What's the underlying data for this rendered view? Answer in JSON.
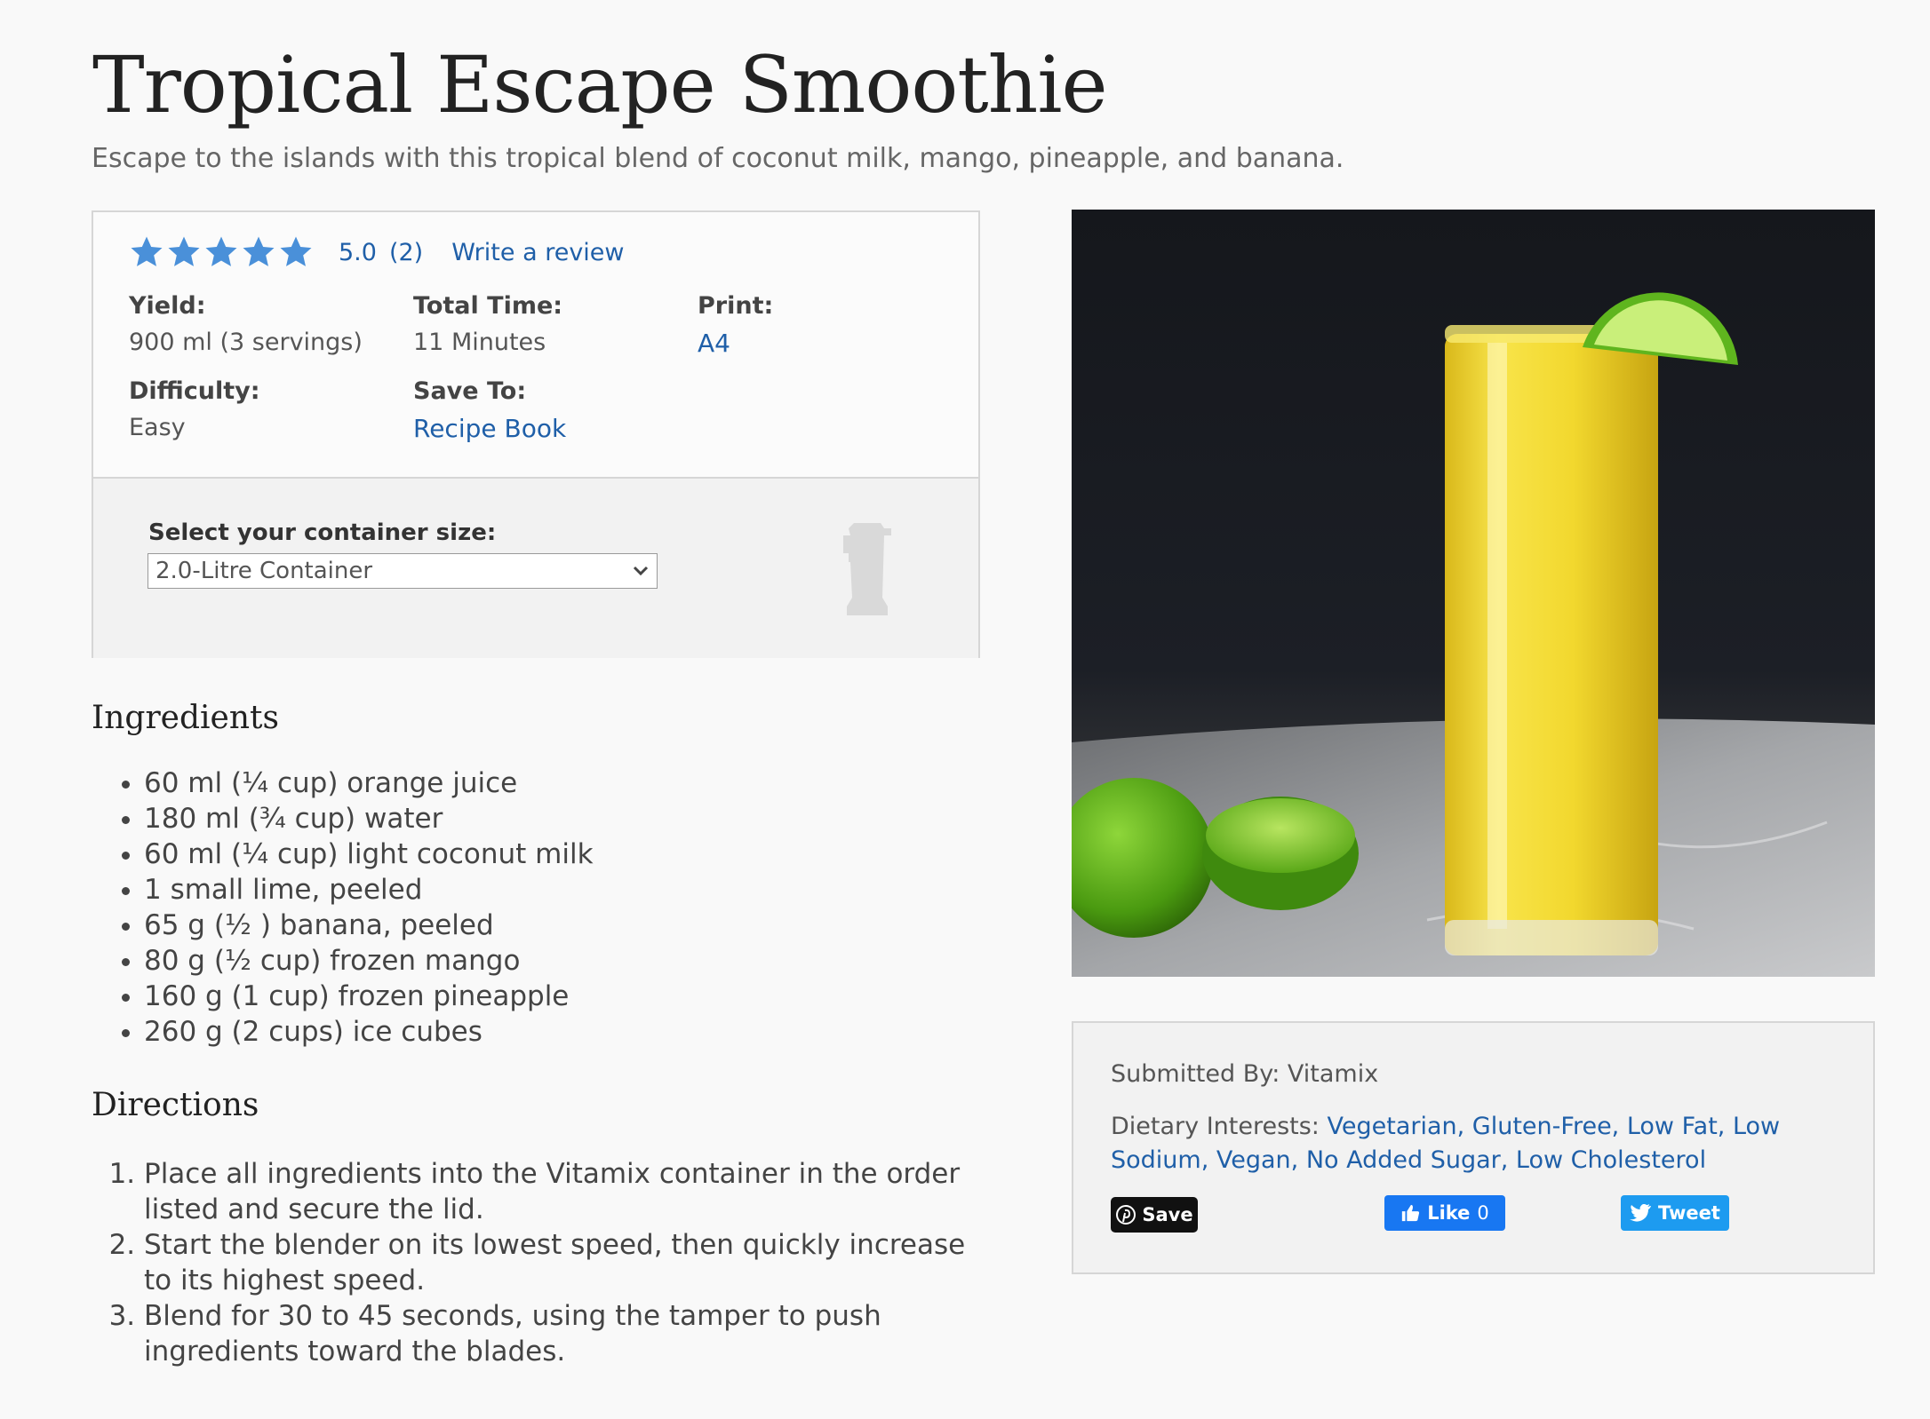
{
  "recipe": {
    "title": "Tropical Escape Smoothie",
    "description": "Escape to the islands with this tropical blend of coconut milk, mango, pineapple, and banana."
  },
  "rating": {
    "stars": 5,
    "value": "5.0",
    "count": "(2)",
    "write_review": "Write a review",
    "star_color": "#4a90d9"
  },
  "meta": {
    "yield_label": "Yield:",
    "yield_value": "900 ml (3 servings)",
    "total_time_label": "Total Time:",
    "total_time_value": "11 Minutes",
    "print_label": "Print:",
    "print_value": "A4",
    "difficulty_label": "Difficulty:",
    "difficulty_value": "Easy",
    "save_to_label": "Save To:",
    "save_to_value": "Recipe Book"
  },
  "container_select": {
    "label": "Select your container size:",
    "selected": "2.0-Litre Container"
  },
  "ingredients": {
    "heading": "Ingredients",
    "items": [
      "60 ml (¼ cup) orange juice",
      "180 ml (¾ cup) water",
      "60 ml (¼ cup) light coconut milk",
      "1 small lime, peeled",
      "65 g (½ ) banana, peeled",
      "80 g (½ cup) frozen mango",
      "160 g (1 cup) frozen pineapple",
      "260 g (2 cups) ice cubes"
    ]
  },
  "directions": {
    "heading": "Directions",
    "steps": [
      "Place all ingredients into the Vitamix container in the order listed and secure the lid.",
      "Start the blender on its lowest speed, then quickly increase to its highest speed.",
      "Blend for 30 to 45 seconds, using the tamper to push ingredients toward the blades."
    ]
  },
  "details": {
    "submitted_by": "Submitted By: Vitamix",
    "dietary_label": "Dietary Interests: ",
    "dietary_values": "Vegetarian, Gluten-Free, Low Fat, Low Sodium, Vegan, No Added Sugar, Low Cholesterol"
  },
  "share": {
    "pinterest_label": "Save",
    "like_label": "Like",
    "like_count": "0",
    "tweet_label": "Tweet"
  },
  "colors": {
    "link": "#1f5fa8",
    "pinterest": "#111111",
    "facebook": "#1877f2",
    "twitter": "#1d9bf0"
  }
}
